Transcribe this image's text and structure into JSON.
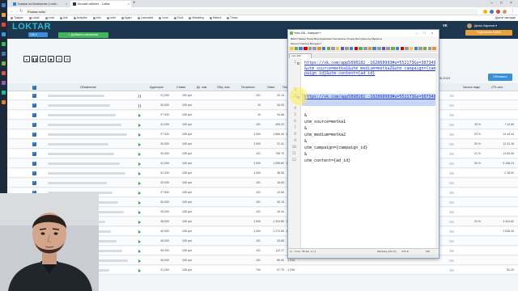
{
  "browser": {
    "tabs": [
      {
        "title": "Трафик на Конверсию | Lead...",
        "color": "#3b83c9",
        "active": false
      },
      {
        "title": "Личный кабинет - Loktar",
        "color": "#1e3750",
        "active": true
      }
    ],
    "url": "loktar.ru/lk/",
    "bookmarks": [
      "Трафик",
      "Loktar",
      "Lead",
      "Ads",
      "Analytics",
      "Ads",
      "Lead",
      "Аудит",
      "Lokmarket",
      "Lead",
      "Tools",
      "Marketing",
      "Metrics",
      "Поиск"
    ],
    "other_bookmarks": "Другие закладки"
  },
  "loktar": {
    "logo": "LOKTAR",
    "account_select": "106 ▾",
    "add_campaign": "+ Добавить кампанию",
    "vk_label": "VK",
    "user_name": "Денис Карпеев ▾",
    "connect_button": "Подключить Блёбс",
    "date": "04.06.2019",
    "refresh_button": "Обновить",
    "toolbar_icons": [
      "●",
      "❚❚",
      "■",
      "▣",
      "⊟",
      "☰"
    ],
    "headers": [
      "Объявление",
      "Аудитория",
      "Ставка",
      "Дн. лим.",
      "Общ. лим.",
      "Потрачено",
      "Охват",
      "Показы",
      "Чистые лиды",
      "CPL чист."
    ],
    "rows": [
      {
        "aud": "21 000",
        "bid": "150 грн",
        "spent": "101",
        "reach": "32.13",
        "shows": "459",
        "st": "pause",
        "lead": "",
        "cpl": ""
      },
      {
        "aud": "30 000",
        "bid": "105 грн",
        "spent": "10",
        "reach": "34.93",
        "shows": "489",
        "st": "pause",
        "lead": "",
        "cpl": ""
      },
      {
        "aud": "37 000",
        "bid": "105 грн",
        "spent": "10",
        "reach": "34.86",
        "shows": "903",
        "st": "play",
        "lead": "",
        "cpl": ""
      },
      {
        "aud": "41 000",
        "bid": "105 грн",
        "spent": "101",
        "reach": "405.23",
        "shows": "5 781",
        "st": "play",
        "lead": "33 %",
        "cpl": "7 12.69"
      },
      {
        "aud": "37 000",
        "bid": "105 грн",
        "spent": "1 000",
        "reach": "1 666.45",
        "shows": "15 321",
        "st": "play",
        "lead": "23 %",
        "cpl": "24 44.44"
      },
      {
        "aud": "20 000",
        "bid": "105 грн",
        "spent": "1 000",
        "reach": "37.41",
        "shows": "449",
        "st": "play",
        "lead": "30 %",
        "cpl": "12 31.16"
      },
      {
        "aud": "30 000",
        "bid": "105 грн",
        "spent": "101",
        "reach": "706.75",
        "shows": "9 371",
        "st": "play",
        "lead": "21 %",
        "cpl": "13 54.06"
      },
      {
        "aud": "41 000",
        "bid": "105 грн",
        "spent": "1 000",
        "reach": "1 059.80",
        "shows": "16 190",
        "st": "play",
        "lead": "30 %",
        "cpl": "9 108.24"
      },
      {
        "aud": "32 000",
        "bid": "105 грн",
        "spent": "1 000",
        "reach": "38.06",
        "shows": "411",
        "st": "play",
        "lead": "",
        "cpl": "0 18.90"
      },
      {
        "aud": "29 000",
        "bid": "105 грн",
        "spent": "101",
        "reach": "16.63",
        "shows": "301",
        "st": "play",
        "lead": "",
        "cpl": ""
      },
      {
        "aud": "27 500",
        "bid": "105 грн",
        "spent": "101",
        "reach": "12.84",
        "shows": "260",
        "st": "play",
        "lead": "",
        "cpl": ""
      },
      {
        "aud": "30 000",
        "bid": "105 грн",
        "spent": "101",
        "reach": "30.15",
        "shows": "538",
        "st": "play",
        "lead": "",
        "cpl": ""
      },
      {
        "aud": "25 000",
        "bid": "105 грн",
        "spent": "101",
        "reach": "19.34",
        "shows": "307",
        "st": "play",
        "lead": "",
        "cpl": ""
      },
      {
        "aud": "28 000",
        "bid": "105 грн",
        "spent": "1 000",
        "reach": "1 324.89",
        "shows": "19 658",
        "st": "play",
        "lead": "20 %",
        "cpl": "3 441.62"
      },
      {
        "aud": "40 000",
        "bid": "105 грн",
        "spent": "1 000",
        "reach": "1 272.65",
        "shows": "18 321",
        "st": "play",
        "lead": "",
        "cpl": "2 636.33"
      },
      {
        "aud": "46 000",
        "bid": "105 грн",
        "spent": "101",
        "reach": "33.68",
        "shows": "466",
        "st": "play",
        "lead": "",
        "cpl": ""
      },
      {
        "aud": "39 000",
        "bid": "105 грн",
        "spent": "101",
        "reach": "112.17",
        "shows": "2 140",
        "st": "play",
        "lead": "",
        "cpl": ""
      },
      {
        "aud": "26 000",
        "bid": "105 грн",
        "spent": "101",
        "reach": "89.90",
        "shows": "1 214",
        "st": "play",
        "lead": "",
        "cpl": ""
      },
      {
        "aud": "21 000",
        "bid": "105 грн",
        "spent": "700",
        "reach": "97.79",
        "shows": "1 298",
        "st": "play",
        "lead": "",
        "cpl": "52.29"
      }
    ]
  },
  "notepad": {
    "title": "*new 106 - Notepad++",
    "menu1": "Файл  Правка  Поиск  Вид  Кодировки  Синтаксисы  Опции  Инструменты  Макросы",
    "menu2": "Запуск  Плагины  Вкладки  ?",
    "tab": "new 106",
    "lines": [
      {
        "n": "1",
        "text": "https://vk.com/app5898182_-162868993#u=552173&s=307349&utm_source=metka1&utm_medium=metka2&utm_campaign={campaign_id}&utm_content={ad_id}",
        "link": true
      },
      {
        "n": "2",
        "text": "",
        "link": false
      },
      {
        "n": "3",
        "text": "https://vk.com/app5898182_-162868993#u=552173&s=307349",
        "link": true,
        "selected": true
      },
      {
        "n": "4",
        "text": "",
        "link": false
      },
      {
        "n": "5",
        "text": "&",
        "link": false
      },
      {
        "n": "6",
        "text": "utm_source=metka1",
        "link": false
      },
      {
        "n": "7",
        "text": "&",
        "link": false
      },
      {
        "n": "8",
        "text": "utm_medium=metka2",
        "link": false
      },
      {
        "n": "9",
        "text": "&",
        "link": false
      },
      {
        "n": "10",
        "text": "utm_campaign={campaign_id}",
        "link": false
      },
      {
        "n": "11",
        "text": "&",
        "link": false
      },
      {
        "n": "12",
        "text": "utm_content={ad_id}",
        "link": false
      }
    ],
    "status": {
      "pos": "Ln : 3   Col : 56   Sel : 0 | 1",
      "eol": "Windows (CR LF)",
      "enc": "UTF-8",
      "ins": "INS"
    }
  }
}
